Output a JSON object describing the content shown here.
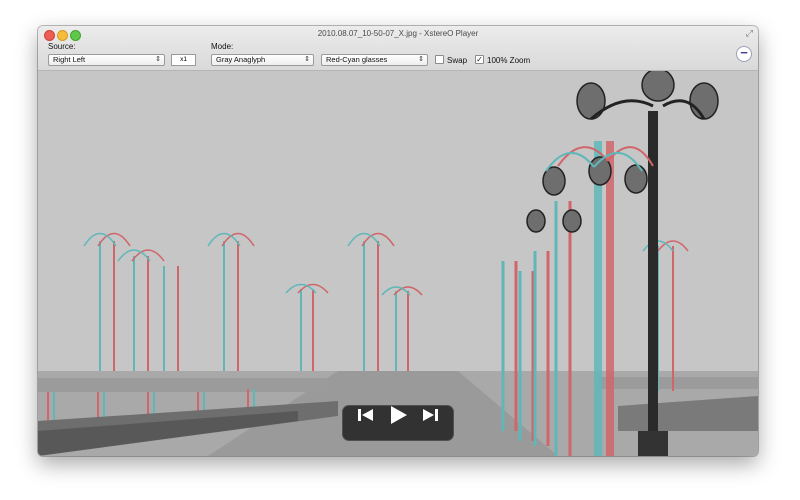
{
  "window": {
    "title": "2010.08.07_10-50-07_X.jpg - XstereO Player"
  },
  "toolbar": {
    "source_label": "Source:",
    "source_value": "Right Left",
    "multiplier": "x1",
    "mode_label": "Mode:",
    "mode_value": "Gray Anaglyph",
    "glasses_value": "Red-Cyan glasses",
    "swap_label": "Swap",
    "swap_checked": false,
    "zoom_label": "100% Zoom",
    "zoom_checked": true
  },
  "playback": {
    "controls": [
      "previous-icon",
      "play-icon",
      "next-icon"
    ]
  },
  "colors": {
    "anaglyph_red": "#d0656a",
    "anaglyph_cyan": "#5fb7b8",
    "close": "#ee5b52",
    "minimize": "#f6bc3c",
    "maximize": "#5fc84a"
  }
}
